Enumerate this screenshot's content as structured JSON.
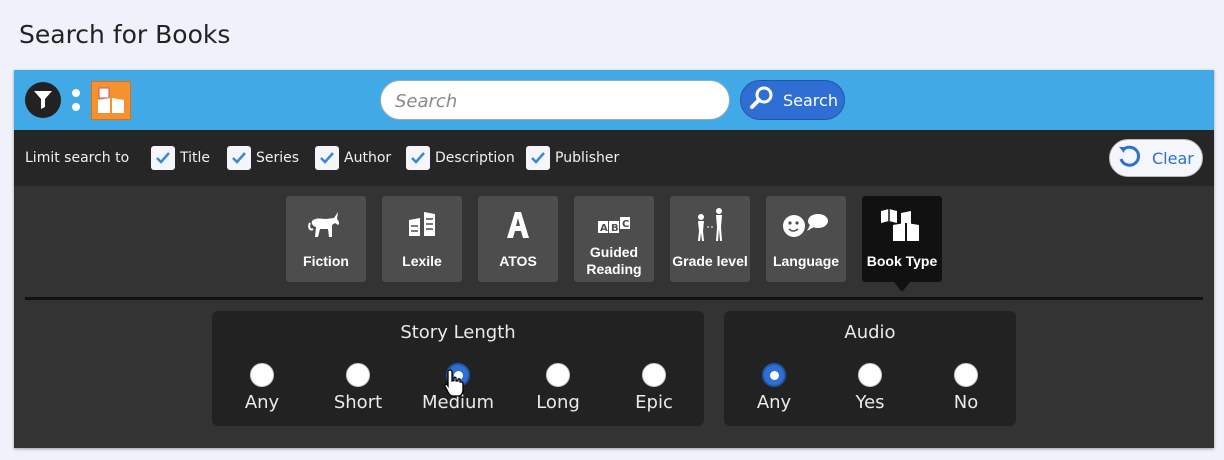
{
  "page": {
    "title": "Search for Books"
  },
  "topbar": {
    "search_placeholder": "Search",
    "search_value": "",
    "search_button_label": "Search",
    "accent_color": "#41a9e6",
    "button_color": "#2f6fd4",
    "badge_color": "#f5912f"
  },
  "limit": {
    "label": "Limit search to",
    "options": [
      {
        "label": "Title",
        "checked": true
      },
      {
        "label": "Series",
        "checked": true
      },
      {
        "label": "Author",
        "checked": true
      },
      {
        "label": "Description",
        "checked": true
      },
      {
        "label": "Publisher",
        "checked": true
      }
    ],
    "clear_label": "Clear"
  },
  "categories": [
    {
      "label": "Fiction",
      "icon": "unicorn-icon",
      "active": false
    },
    {
      "label": "Lexile",
      "icon": "books-icon",
      "active": false
    },
    {
      "label": "ATOS",
      "icon": "letter-a-icon",
      "active": false
    },
    {
      "label": "Guided Reading",
      "icon": "abc-blocks-icon",
      "active": false
    },
    {
      "label": "Grade level",
      "icon": "children-height-icon",
      "active": false
    },
    {
      "label": "Language",
      "icon": "speech-face-icon",
      "active": false
    },
    {
      "label": "Book Type",
      "icon": "open-books-icon",
      "active": true
    }
  ],
  "story_length": {
    "title": "Story Length",
    "options": [
      "Any",
      "Short",
      "Medium",
      "Long",
      "Epic"
    ],
    "selected": "Medium"
  },
  "audio": {
    "title": "Audio",
    "options": [
      "Any",
      "Yes",
      "No"
    ],
    "selected": "Any"
  }
}
